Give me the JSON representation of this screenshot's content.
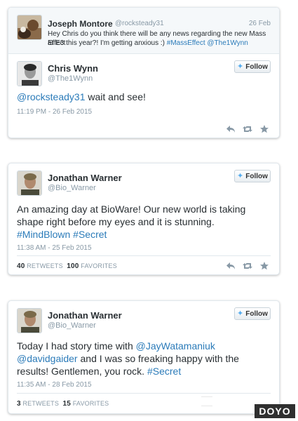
{
  "tweet1": {
    "reply": {
      "name": "Joseph Montore",
      "handle": "@rocksteady31",
      "date": "26 Feb",
      "text_line1": "Hey Chris do you think there will be any news regarding the new Mass Effect",
      "text_line2_plain": "at E3 this year?! I'm getting anxious :) ",
      "hashtag": "#MassEffect",
      "mention": "@The1Wynn"
    },
    "name": "Chris Wynn",
    "handle": "@The1Wynn",
    "follow_label": "Follow",
    "mention": "@rocksteady31",
    "text": " wait and see!",
    "timestamp": "11:19 PM - 26 Feb 2015"
  },
  "tweet2": {
    "name": "Jonathan Warner",
    "handle": "@Bio_Warner",
    "follow_label": "Follow",
    "line1": "An amazing day at BioWare! Our new world is taking",
    "line2": "shape right before my eyes and it is stunning.",
    "hashtag1": "#MindBlown",
    "hashtag2": "#Secret",
    "timestamp": "11:38 AM - 25 Feb 2015",
    "retweets_count": "40",
    "retweets_label": "RETWEETS",
    "favorites_count": "100",
    "favorites_label": "FAVORITES"
  },
  "tweet3": {
    "name": "Jonathan Warner",
    "handle": "@Bio_Warner",
    "follow_label": "Follow",
    "line1_plain": "Today I had story time with ",
    "mention1": "@JayWatamaniuk",
    "mention2": "@davidgaider",
    "line2_plain": " and I was so freaking happy with the",
    "line3_plain": "results! Gentlemen, you rock. ",
    "hashtag": "#Secret",
    "timestamp": "11:35 AM - 28 Feb 2015",
    "retweets_count": "3",
    "retweets_label": "RETWEETS",
    "favorites_count": "15",
    "favorites_label": "FAVORITES"
  },
  "watermark": "DOYO",
  "colors": {
    "link": "#2b7bb9",
    "bird": "#55acee",
    "muted": "#8899a6"
  }
}
